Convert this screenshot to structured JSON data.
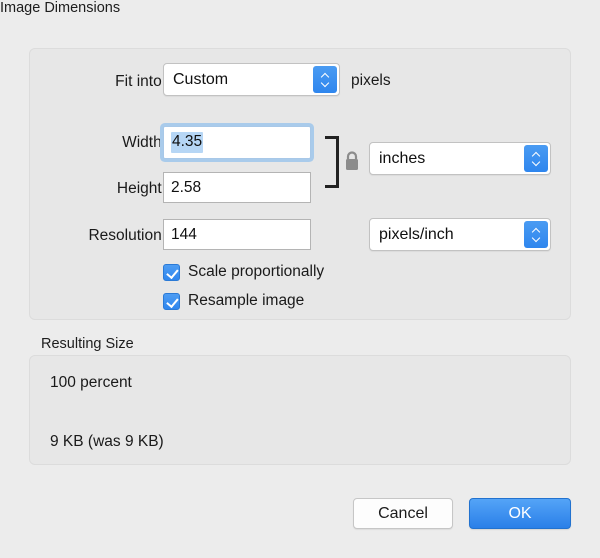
{
  "dialog": {
    "sections": {
      "image_dimensions": {
        "title": "Image Dimensions",
        "fit_into": {
          "label": "Fit into:",
          "value": "Custom",
          "suffix": "pixels"
        },
        "width": {
          "label": "Width:",
          "value": "4.35",
          "focused": true,
          "selected": true
        },
        "height": {
          "label": "Height:",
          "value": "2.58"
        },
        "units": {
          "value": "inches"
        },
        "resolution": {
          "label": "Resolution:",
          "value": "144"
        },
        "resolution_units": {
          "value": "pixels/inch"
        },
        "link_lock": {
          "icon": "lock-closed-icon",
          "state": "locked"
        },
        "checkboxes": [
          {
            "label": "Scale proportionally",
            "checked": true
          },
          {
            "label": "Resample image",
            "checked": true
          }
        ]
      },
      "resulting_size": {
        "title": "Resulting Size",
        "percent_line": "100 percent",
        "size_line": "9 KB (was 9 KB)"
      }
    },
    "buttons": {
      "cancel": "Cancel",
      "ok": "OK"
    },
    "colors": {
      "accent_blue": "#2f86ee",
      "ok_gradient_top": "#54a4f7",
      "ok_gradient_bottom": "#2a7fe8",
      "focus_ring": "#a9cbeb",
      "selection": "#b6d6f5",
      "window_background": "#ececec",
      "group_background": "#e7e7e7"
    }
  }
}
